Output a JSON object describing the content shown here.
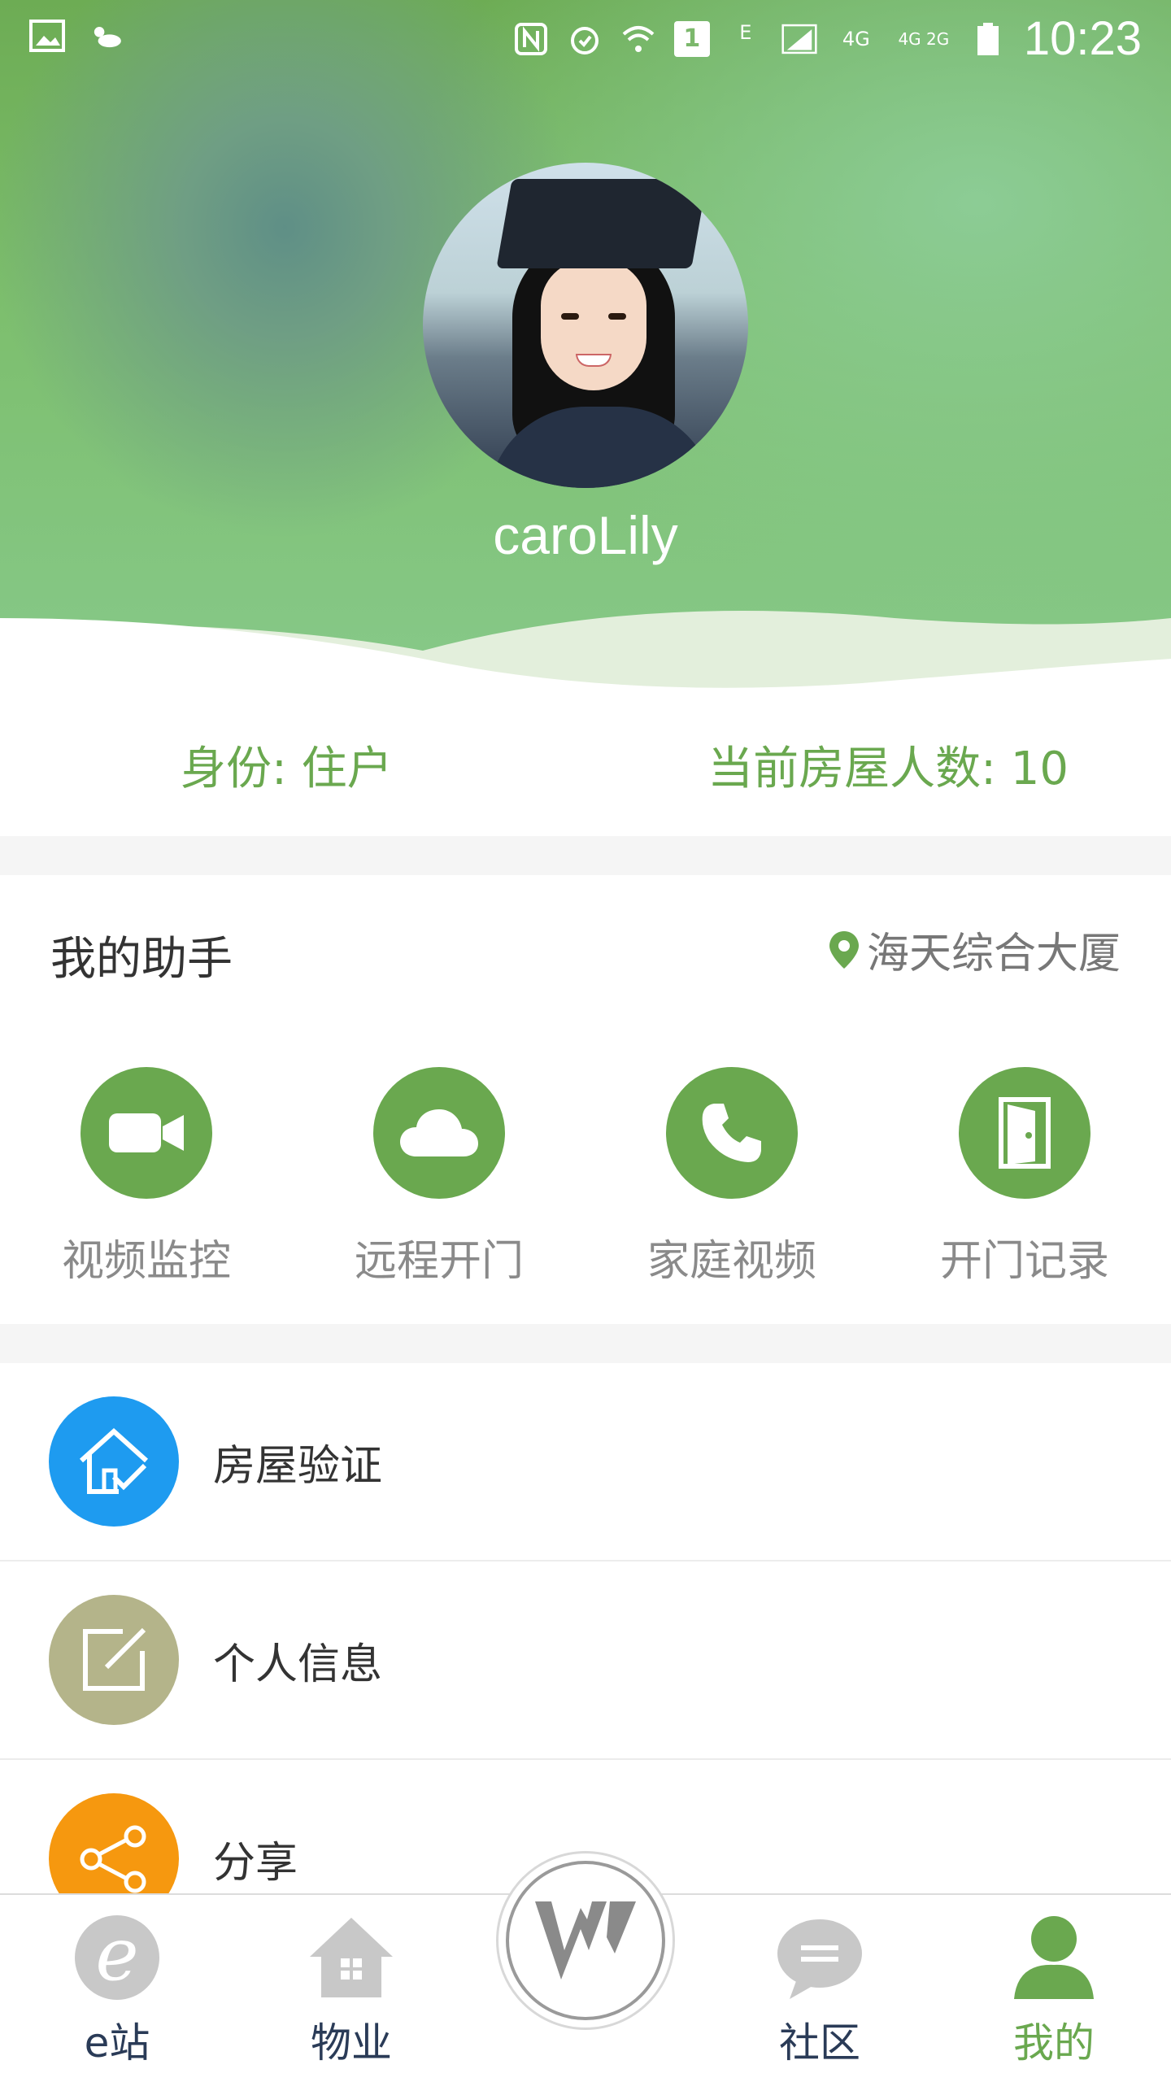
{
  "statusbar": {
    "time": "10:23",
    "network_e": "E",
    "network_4g": "4G",
    "network_4g_2g": "4G 2G",
    "sim_badge": "1"
  },
  "profile": {
    "username": "caroLily"
  },
  "identity": {
    "role_text": "身份: 住户",
    "household_text": "当前房屋人数: 10"
  },
  "assistant": {
    "title": "我的助手",
    "location": "海天综合大厦",
    "tools": [
      {
        "label": "视频监控",
        "icon": "video-camera-icon"
      },
      {
        "label": "远程开门",
        "icon": "cloud-icon"
      },
      {
        "label": "家庭视频",
        "icon": "phone-icon"
      },
      {
        "label": "开门记录",
        "icon": "door-icon"
      }
    ]
  },
  "menu": [
    {
      "label": "房屋验证",
      "icon": "house-check-icon",
      "color": "#1e9bf0"
    },
    {
      "label": "个人信息",
      "icon": "edit-icon",
      "color": "#b4b48a"
    },
    {
      "label": "分享",
      "icon": "share-icon",
      "color": "#f6980f"
    }
  ],
  "nav": {
    "items": [
      {
        "label": "e站",
        "icon": "e-station-icon"
      },
      {
        "label": "物业",
        "icon": "property-house-icon"
      },
      {
        "label": "社区",
        "icon": "chat-bubble-icon"
      },
      {
        "label": "我的",
        "icon": "person-icon",
        "active": true
      }
    ],
    "center_icon": "brand-logo-icon"
  },
  "colors": {
    "accent": "#6aa84f",
    "nav_text": "#2a3b57",
    "blue": "#1e9bf0",
    "olive": "#b4b48a",
    "orange": "#f6980f"
  }
}
